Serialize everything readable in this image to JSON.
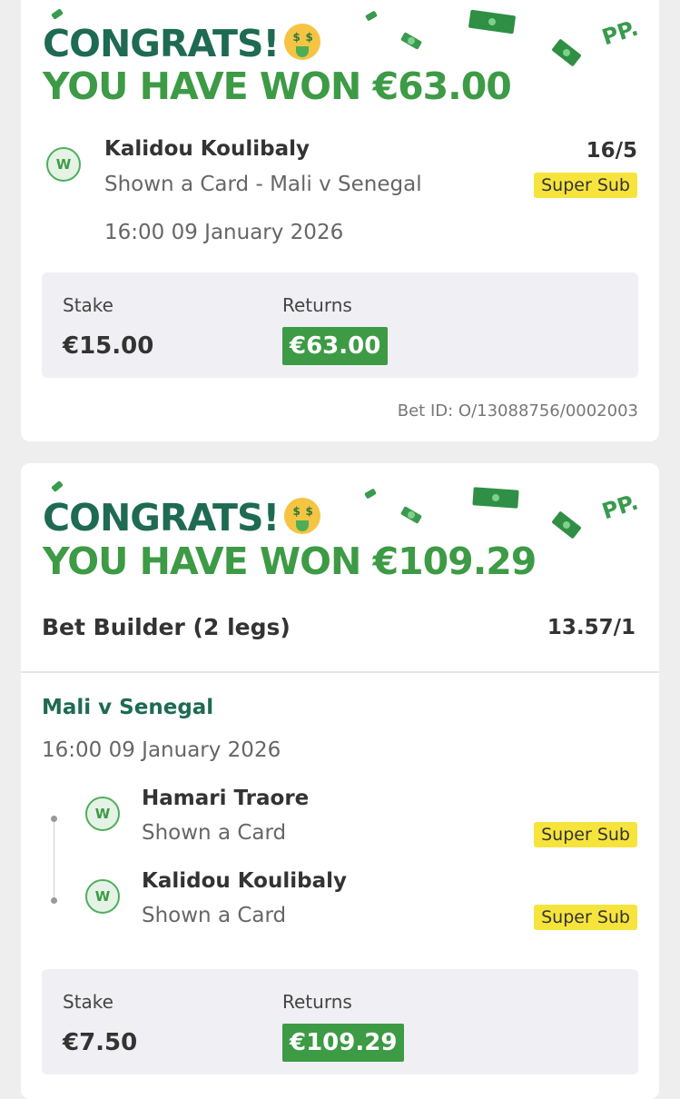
{
  "cards": [
    {
      "congrats_text": "CONGRATS!",
      "won_text": "YOU HAVE WON €63.00",
      "logo": "PP.",
      "selection": {
        "badge": "W",
        "player": "Kalidou Koulibaly",
        "market": "Shown a Card - Mali v Senegal",
        "odds": "16/5",
        "tag": "Super Sub",
        "datetime": "16:00 09 January 2026"
      },
      "stake_label": "Stake",
      "stake_value": "€15.00",
      "returns_label": "Returns",
      "returns_value": "€63.00",
      "bet_id": "Bet ID: O/13088756/0002003"
    },
    {
      "congrats_text": "CONGRATS!",
      "won_text": "YOU HAVE WON €109.29",
      "logo": "PP.",
      "builder_title": "Bet Builder (2 legs)",
      "builder_odds": "13.57/1",
      "event": "Mali v Senegal",
      "datetime": "16:00 09 January 2026",
      "legs": [
        {
          "badge": "W",
          "player": "Hamari Traore",
          "market": "Shown a Card",
          "tag": "Super Sub"
        },
        {
          "badge": "W",
          "player": "Kalidou Koulibaly",
          "market": "Shown a Card",
          "tag": "Super Sub"
        }
      ],
      "stake_label": "Stake",
      "stake_value": "€7.50",
      "returns_label": "Returns",
      "returns_value": "€109.29"
    }
  ],
  "icons": {
    "emoji": "money-mouth-face-icon",
    "confetti": "banknote-confetti-icon",
    "badge": "win-badge-icon"
  },
  "colors": {
    "win_green": "#3d9a45",
    "dark_green": "#1e6a52",
    "super_sub_yellow": "#f6e43d"
  }
}
